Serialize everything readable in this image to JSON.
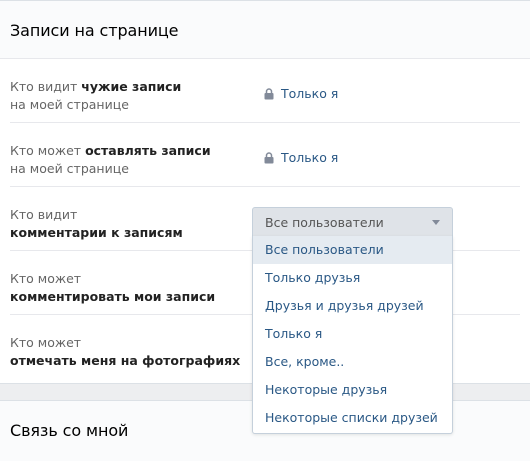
{
  "section1": {
    "title": "Записи на странице",
    "rows": [
      {
        "pre": "Кто видит ",
        "bold": "чужие записи",
        "post": "на моей странице",
        "value": "Только я",
        "icon": "lock-icon"
      },
      {
        "pre": "Кто может ",
        "bold": "оставлять записи",
        "post": "на моей странице",
        "value": "Только я",
        "icon": "lock-icon"
      },
      {
        "pre": "Кто видит",
        "bold": "комментарии к записям",
        "post": ""
      },
      {
        "pre": "Кто может",
        "bold": "комментировать мои записи",
        "post": ""
      },
      {
        "pre": "Кто может",
        "bold": "отмечать меня на фотографиях",
        "post": ""
      }
    ]
  },
  "select": {
    "value": "Все пользователи",
    "icon": "chevron-down-icon",
    "options": [
      "Все пользователи",
      "Только друзья",
      "Друзья и друзья друзей",
      "Только я",
      "Все, кроме..",
      "Некоторые друзья",
      "Некоторые списки друзей"
    ],
    "highlighted_index": 0
  },
  "section2": {
    "title": "Связь со мной"
  },
  "colors": {
    "link": "#2a5885",
    "label": "#656565",
    "select_bg": "#dfe3e8",
    "highlight": "#e5ebf1"
  }
}
